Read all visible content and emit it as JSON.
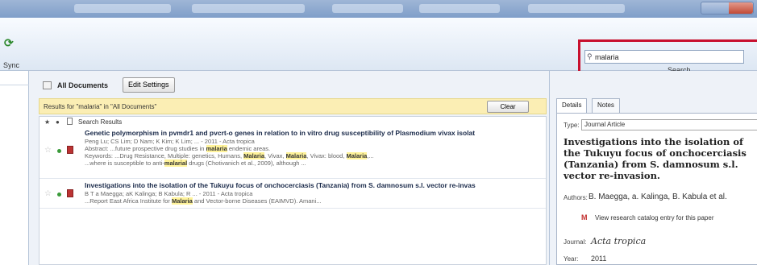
{
  "toolbar": {
    "sync_label": "Sync",
    "search_value": "malaria",
    "search_icon_glyph": "⚲",
    "search_label": "Search"
  },
  "library": {
    "title": "All Documents",
    "edit_settings_label": "Edit Settings"
  },
  "results": {
    "text": "Results for \"malaria\" in \"All Documents\"",
    "clear_label": "Clear"
  },
  "list": {
    "header": "Search Results",
    "rows": [
      {
        "title": "Genetic polymorphism in pvmdr1 and pvcrt-o genes in relation to in vitro drug susceptibility of Plasmodium vivax isolat",
        "meta": "Peng Lu; CS Lim; D Nam; K Kim; K Lim; ... - 2011 - Acta tropica",
        "abstract_pre": "Abstract: ...future prospective drug studies in ",
        "abstract_hl": "malaria",
        "abstract_post": " endemic areas.",
        "keywords_pre": "Keywords: ...Drug Resistance, Multiple: genetics, Humans, ",
        "keywords_hl1": "Malaria",
        "keywords_mid": ", Vivax, ",
        "keywords_hl2": "Malaria",
        "keywords_mid2": ", Vivax: blood, ",
        "keywords_hl3": "Malaria",
        "keywords_post": ",...",
        "line4_pre": "...where is susceptible to anti-",
        "line4_hl": "malarial",
        "line4_post": " drugs (Chotivanich et al., 2009), although ...",
        "dot_color": "#3a9a3a"
      },
      {
        "title": "Investigations into the isolation of the Tukuyu focus of onchocerciasis (Tanzania) from S. damnosum s.l. vector re-invas",
        "meta": "B T a Maegga; aK Kalinga; B Kabula; R ... - 2011 - Acta tropica",
        "line2_pre": "...Report East Africa Institute for ",
        "line2_hl": "Malaria",
        "line2_post": " and Vector-borne Diseases (EAIMVD). Amani...",
        "dot_color": "#3a9a3a"
      }
    ]
  },
  "details": {
    "tab_details": "Details",
    "tab_notes": "Notes",
    "type_label": "Type:",
    "type_value": "Journal Article",
    "title": "Investigations into the isolation of the Tukuyu focus of onchocerciasis (Tanzania) from S. damnosum s.l. vector re-invasion.",
    "authors_label": "Authors:",
    "authors_value": "B. Maegga, a. Kalinga, B. Kabula et al.",
    "catalog_icon": "M",
    "catalog_link": "View research catalog entry for this paper",
    "journal_label": "Journal:",
    "journal_value": "Acta tropica",
    "year_label": "Year:",
    "year_value": "2011"
  },
  "colors": {
    "highlight_border": "#c8102e",
    "results_bar": "#fbeeb4",
    "keyword_highlight": "#fff39a"
  }
}
